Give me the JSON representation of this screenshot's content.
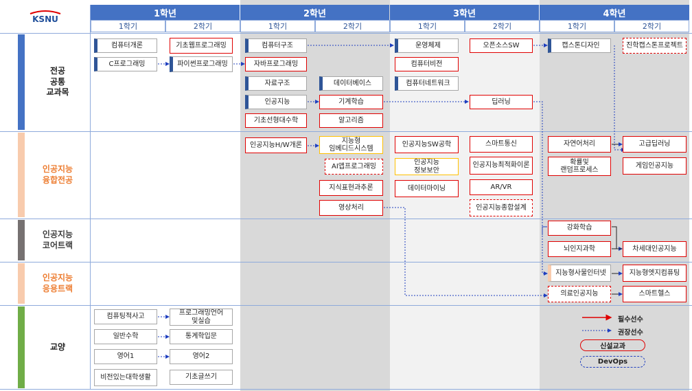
{
  "logo": {
    "text": "KSNU"
  },
  "years": [
    "1학년",
    "2학년",
    "3학년",
    "4학년"
  ],
  "semesters": [
    "1학기",
    "2학기",
    "1학기",
    "2학기",
    "1학기",
    "2학기",
    "1학기",
    "2학기"
  ],
  "rows": [
    {
      "label": "전공\n공통\n교과목",
      "color": "#4472c4",
      "text_color": "#222222"
    },
    {
      "label": "인공지능\n융합전공",
      "color": "#f8cbad",
      "text_color": "#ed7d31"
    },
    {
      "label": "인공지능\n코어트랙",
      "color": "#767171",
      "text_color": "#404040"
    },
    {
      "label": "인공지능\n응용트랙",
      "color": "#f8cbad",
      "text_color": "#ed7d31"
    },
    {
      "label": "교양",
      "color": "#70ad47",
      "text_color": "#222222"
    }
  ],
  "courses": [
    {
      "text": "컴퓨터개론",
      "style": "lb-blue"
    },
    {
      "text": "C프로그래밍",
      "style": "lb-blue"
    },
    {
      "text": "기초웹프로그래밍",
      "style": "lb-blue red-solid"
    },
    {
      "text": "파이썬프로그래밍",
      "style": "lb-blue"
    },
    {
      "text": "컴퓨터구조",
      "style": "lb-blue"
    },
    {
      "text": "자바프로그래밍",
      "style": "lb-blue red-solid"
    },
    {
      "text": "자료구조",
      "style": "lb-blue"
    },
    {
      "text": "인공지능",
      "style": "lb-blue"
    },
    {
      "text": "기초선형대수학",
      "style": "lb-blue red-solid"
    },
    {
      "text": "데이터베이스",
      "style": "lb-blue"
    },
    {
      "text": "기계학습",
      "style": "lb-blue red-solid"
    },
    {
      "text": "알고리즘",
      "style": "lb-blue red-solid"
    },
    {
      "text": "운영체제",
      "style": "lb-blue"
    },
    {
      "text": "컴퓨터비전",
      "style": "lb-blue red-solid"
    },
    {
      "text": "컴퓨터네트워크",
      "style": "lb-blue"
    },
    {
      "text": "오픈소스SW",
      "style": "lb-blue red-solid"
    },
    {
      "text": "딥러닝",
      "style": "lb-blue red-solid"
    },
    {
      "text": "캡스톤디자인",
      "style": "lb-blue"
    },
    {
      "text": "진학캡스톤프로젝트",
      "style": "lb-blue red-dash"
    },
    {
      "text": "인공지능H/W개론",
      "style": "lb-peach red-solid"
    },
    {
      "text": "지능형\n임베디드시스템",
      "style": "lb-peach yel"
    },
    {
      "text": "AI앱프로그래밍",
      "style": "lb-peach red-dash"
    },
    {
      "text": "지식표현과추론",
      "style": "lb-peach red-solid"
    },
    {
      "text": "영상처리",
      "style": "lb-peach red-solid"
    },
    {
      "text": "인공지능SW공학",
      "style": "lb-peach red-solid"
    },
    {
      "text": "인공지능\n정보보안",
      "style": "lb-peach yel"
    },
    {
      "text": "데이터마이닝",
      "style": "lb-peach red-solid"
    },
    {
      "text": "스마트통신",
      "style": "lb-peach red-solid"
    },
    {
      "text": "인공지능최적화이론",
      "style": "lb-peach red-solid"
    },
    {
      "text": "AR/VR",
      "style": "lb-peach red-solid"
    },
    {
      "text": "인공지능종합설계",
      "style": "lb-peach red-dash"
    },
    {
      "text": "자연어처리",
      "style": "lb-peach red-solid"
    },
    {
      "text": "확률및\n랜덤프로세스",
      "style": "lb-peach red-solid"
    },
    {
      "text": "고급딥러닝",
      "style": "lb-peach red-solid"
    },
    {
      "text": "게임인공지능",
      "style": "lb-peach red-solid"
    },
    {
      "text": "강화학습",
      "style": "lb-gray red-solid"
    },
    {
      "text": "뇌인지과학",
      "style": "lb-gray red-solid"
    },
    {
      "text": "차세대인공지능",
      "style": "lb-gray red-solid"
    },
    {
      "text": "지능형사물인터넷",
      "style": "lb-peach"
    },
    {
      "text": "지능형엣지컴퓨팅",
      "style": "lb-peach red-solid"
    },
    {
      "text": "의료인공지능",
      "style": "lb-peach red-dash"
    },
    {
      "text": "스마트헬스",
      "style": "lb-peach red-solid"
    },
    {
      "text": "컴퓨팅적사고",
      "style": ""
    },
    {
      "text": "프로그래밍언어\n및실습",
      "style": ""
    },
    {
      "text": "일반수학",
      "style": ""
    },
    {
      "text": "통계학입문",
      "style": ""
    },
    {
      "text": "영어1",
      "style": ""
    },
    {
      "text": "영어2",
      "style": ""
    },
    {
      "text": "비전있는대학생활",
      "style": ""
    },
    {
      "text": "기초글쓰기",
      "style": ""
    }
  ],
  "legend": {
    "required": "필수선수",
    "recommended": "권장선수",
    "new_course": "신설교과",
    "devops": "DevOps",
    "red": "#e00000",
    "blue": "#1f3fbf"
  }
}
